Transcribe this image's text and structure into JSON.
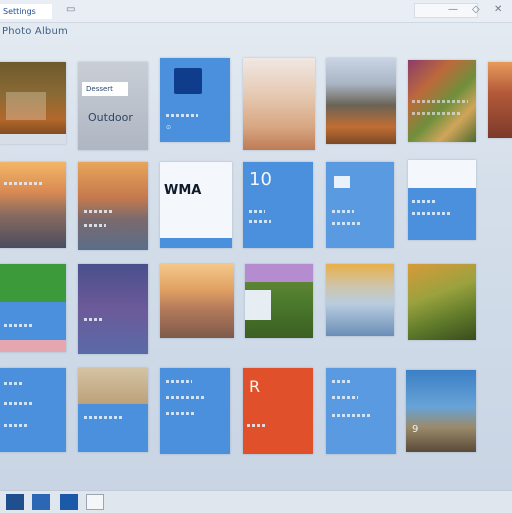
{
  "window": {
    "title": "Settings",
    "search_placeholder": ""
  },
  "section": {
    "header": "Photo Album"
  },
  "tiles": {
    "row1": {
      "t2_caption_top": "Dessert",
      "t2_caption": "Outdoor"
    },
    "row2": {
      "t3_caption": "WMA",
      "t4_number": "10"
    },
    "row4": {
      "t4_letter": "R",
      "t6_number": "9"
    }
  },
  "taskbar": {
    "items": [
      "start",
      "folder",
      "photos",
      "window"
    ]
  }
}
